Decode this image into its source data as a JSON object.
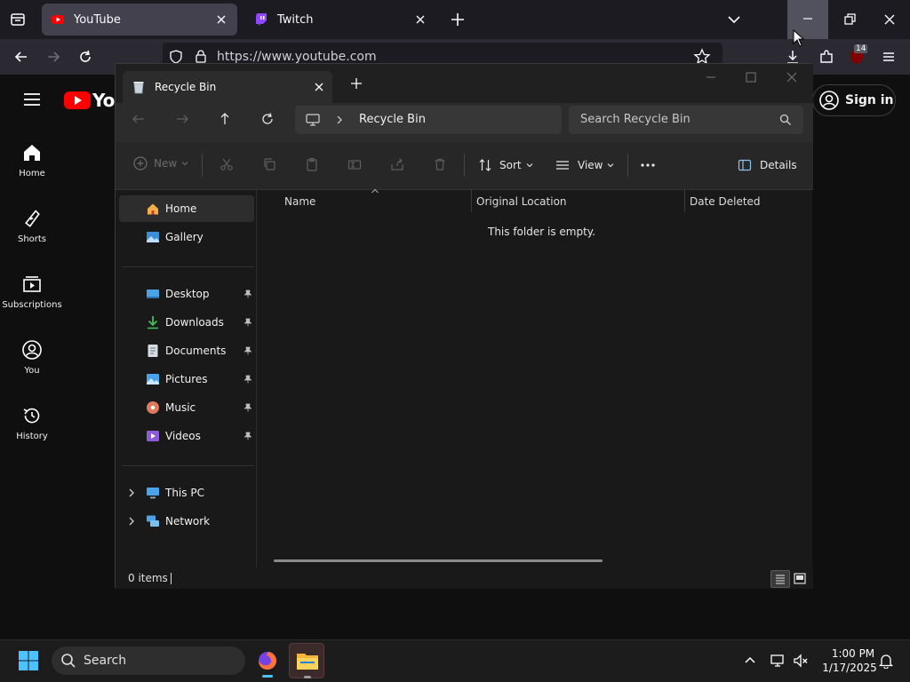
{
  "browser": {
    "tabs": [
      {
        "title": "YouTube",
        "active": true
      },
      {
        "title": "Twitch",
        "active": false
      }
    ],
    "url": "https://www.youtube.com",
    "notification_count": "14"
  },
  "youtube": {
    "nav": [
      {
        "label": "Home",
        "icon": "home-icon"
      },
      {
        "label": "Shorts",
        "icon": "shorts-icon"
      },
      {
        "label": "Subscriptions",
        "icon": "subscriptions-icon"
      },
      {
        "label": "You",
        "icon": "user-icon"
      },
      {
        "label": "History",
        "icon": "history-icon"
      }
    ],
    "logo_text": "You",
    "sign_in_label": "Sign in"
  },
  "explorer": {
    "tab_title": "Recycle Bin",
    "breadcrumb": "Recycle Bin",
    "search_placeholder": "Search Recycle Bin",
    "toolbar": {
      "new_label": "New",
      "sort_label": "Sort",
      "view_label": "View",
      "details_label": "Details"
    },
    "nav": {
      "home": "Home",
      "gallery": "Gallery",
      "pinned": [
        "Desktop",
        "Downloads",
        "Documents",
        "Pictures",
        "Music",
        "Videos"
      ],
      "this_pc": "This PC",
      "network": "Network"
    },
    "columns": [
      "Name",
      "Original Location",
      "Date Deleted"
    ],
    "empty_message": "This folder is empty.",
    "status": "0 items"
  },
  "taskbar": {
    "search_label": "Search",
    "time": "1:00 PM",
    "date": "1/17/2025"
  },
  "colors": {
    "youtube_red": "#ff0000",
    "twitch_purple": "#9146ff",
    "taskbar_bg": "#1c1c1c"
  }
}
